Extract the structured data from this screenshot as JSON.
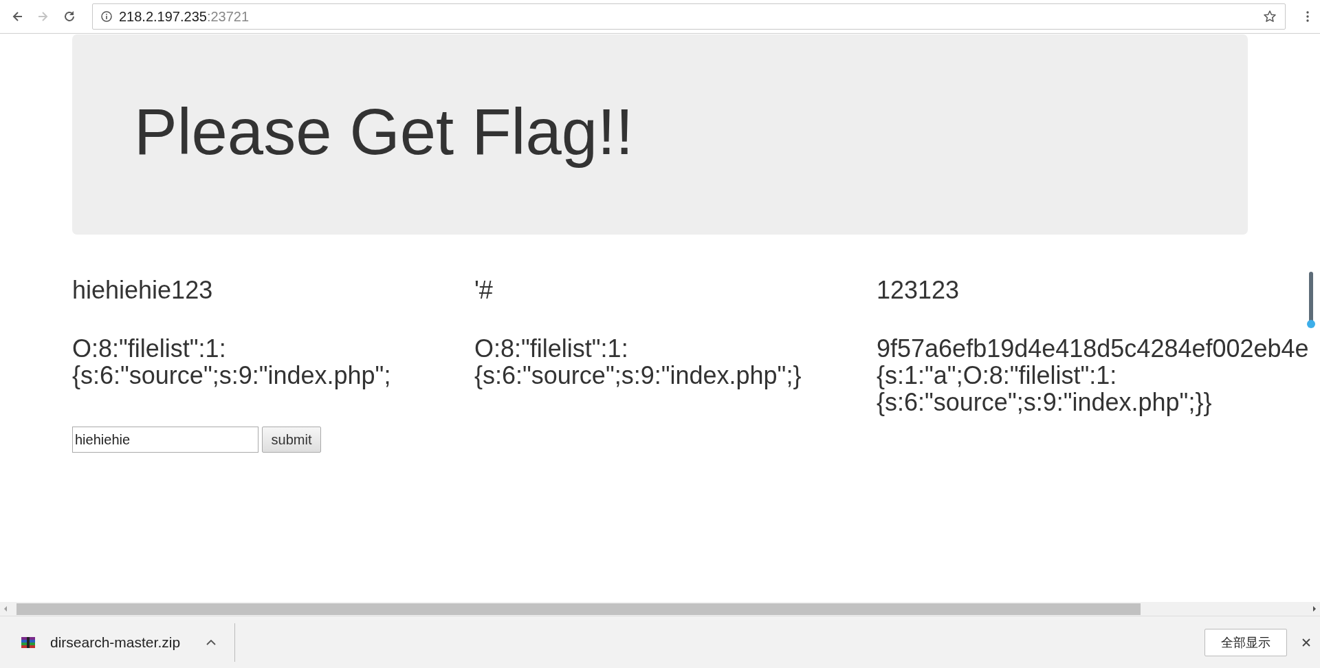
{
  "browser": {
    "nav": [
      {
        "kind": "back",
        "disabled": false
      },
      {
        "kind": "forward",
        "disabled": true
      },
      {
        "kind": "reload",
        "disabled": false
      }
    ],
    "url_host": "218.2.197.235",
    "url_port": ":23721"
  },
  "jumbotron": {
    "heading": "Please Get Flag!!"
  },
  "columns": [
    {
      "title": "hiehiehie123",
      "lines": [
        "O:8:\"filelist\":1:",
        "{s:6:\"source\";s:9:\"index.php\";"
      ]
    },
    {
      "title": "'#",
      "lines": [
        "O:8:\"filelist\":1:",
        "{s:6:\"source\";s:9:\"index.php\";}"
      ]
    },
    {
      "title": "123123",
      "lines": [
        "9f57a6efb19d4e418d5c4284ef002eb4e",
        "{s:1:\"a\";O:8:\"filelist\":1:",
        "{s:6:\"source\";s:9:\"index.php\";}}"
      ]
    }
  ],
  "form": {
    "value": "hiehiehie",
    "button": "submit"
  },
  "download_bar": {
    "file": "dirsearch-master.zip",
    "show_all": "全部显示"
  }
}
